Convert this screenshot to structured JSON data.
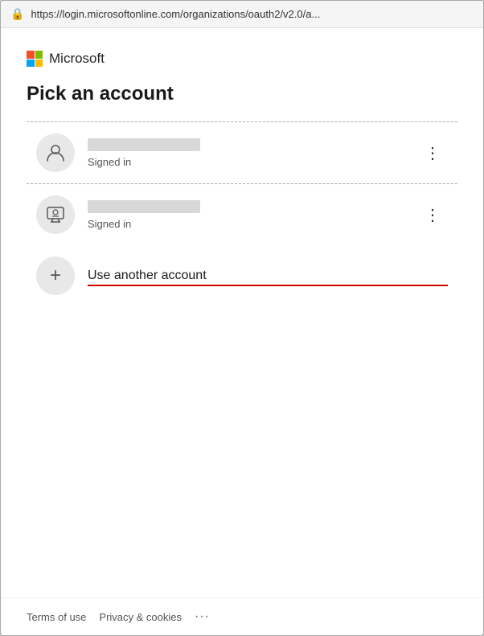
{
  "browser": {
    "url": "https://login.microsoftonline.com/organizations/oauth2/v2.0/a..."
  },
  "microsoft": {
    "logo_text": "Microsoft"
  },
  "page": {
    "title": "Pick an account"
  },
  "accounts": [
    {
      "id": "account-1",
      "status": "Signed in",
      "avatar_type": "person"
    },
    {
      "id": "account-2",
      "status": "Signed in",
      "avatar_type": "tv"
    }
  ],
  "use_another": {
    "label": "Use another account"
  },
  "footer": {
    "terms_label": "Terms of use",
    "privacy_label": "Privacy & cookies",
    "more_label": "···"
  }
}
